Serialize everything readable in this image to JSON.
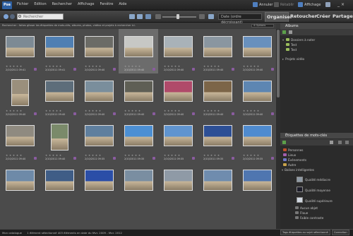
{
  "app": {
    "logo": "Pse"
  },
  "menu": [
    "Fichier",
    "Edition",
    "Rechercher",
    "Affichage",
    "Fenêtre",
    "Aide"
  ],
  "top_right": {
    "undo": "Annuler",
    "redo": "Rétablir",
    "view": "Affichage"
  },
  "search": {
    "placeholder": "Rechercher"
  },
  "sort": {
    "selected": "Date (ordre décroissant)"
  },
  "tabs": [
    "Organiser",
    "Retoucher",
    "Créer",
    "Partager"
  ],
  "filter": {
    "hint": "Rechercher : faites glisser les étiquettes de mots-clés, albums, photos, vidéos et projets à rechercher ici.",
    "dropdown": "4 Options"
  },
  "colors": {
    "accent": "#8a5c9f",
    "selection": "#6c6c6c",
    "panel": "#2b2b2b"
  },
  "thumb_tones": [
    [
      "#7d8a94",
      "#4f7fb3",
      "#6b6b66",
      "#c7c8c5",
      "#a9b2b8",
      "#8a96a0",
      "#6890bd"
    ],
    [
      "#9a8f7c",
      "#5d6d7a",
      "#7a8e9c",
      "#5f5f55",
      "#b04a6a",
      "#7c6548",
      "#5d86b2"
    ],
    [
      "#8f8a80",
      "#7a8a6a",
      "#5f7f9e",
      "#4c8fd3",
      "#6094cf",
      "#2d4f95",
      "#4f8bcf"
    ],
    [
      "#6e8aa8",
      "#3f5d86",
      "#2b4ea7",
      "#7a8ea1",
      "#8f9aa6",
      "#6f8cae",
      "#4f76b0"
    ]
  ],
  "cells": [
    [
      {
        "date": "2/10/2011 09:41"
      },
      {
        "date": "2/10/2011 09:41"
      },
      {
        "date": "2/10/2011 09:40"
      },
      {
        "date": "2/10/2011 09:40"
      },
      {
        "date": "2/10/2011 09:40"
      },
      {
        "date": "2/10/2011 09:40"
      },
      {
        "date": "2/10/2011 09:40"
      }
    ],
    [
      {
        "date": "2/10/2011 09:40"
      },
      {
        "date": "2/10/2011 09:40"
      },
      {
        "date": "2/10/2011 09:40"
      },
      {
        "date": "2/10/2011 09:40"
      },
      {
        "date": "2/10/2011 09:40"
      },
      {
        "date": "2/10/2011 09:40"
      },
      {
        "date": "2/10/2011 09:40"
      }
    ],
    [
      {
        "date": "2/10/2011 09:40"
      },
      {
        "date": "2/10/2011 09:40"
      },
      {
        "date": "2/10/2011 09:35"
      },
      {
        "date": "2/10/2011 09:35"
      },
      {
        "date": "2/10/2011 09:35"
      },
      {
        "date": "2/10/2011 09:35"
      },
      {
        "date": "2/10/2011 09:35"
      }
    ],
    [
      {
        "date": ""
      },
      {
        "date": ""
      },
      {
        "date": ""
      },
      {
        "date": ""
      },
      {
        "date": ""
      },
      {
        "date": ""
      },
      {
        "date": ""
      }
    ]
  ],
  "stars": "★ ★ ★ ★ ★",
  "albums": {
    "title": "Albums",
    "items": [
      {
        "label": "Dossiers à noter"
      },
      {
        "label": "Test"
      },
      {
        "label": "Test"
      },
      {
        "label": "Projets vidéo"
      }
    ]
  },
  "keywords": {
    "title": "Étiquettes de mots-clés",
    "items": [
      {
        "label": "Personnes"
      },
      {
        "label": "Lieux"
      },
      {
        "label": "Événements"
      },
      {
        "label": "Autre"
      },
      {
        "label": "Balises intelligentes"
      },
      {
        "label": "Qualité médiocre"
      },
      {
        "label": "Qualité moyenne"
      },
      {
        "label": "Qualité supérieure"
      },
      {
        "label": "Aucun objet"
      },
      {
        "label": "Floue"
      },
      {
        "label": "Faible contraste"
      }
    ]
  },
  "status": {
    "catalog": "Mon catalogue",
    "selection": "1 élément sélectionné  403 éléments en date du févr. 2009 - févr. 2012",
    "tag_button": "Tags étiquettes au sujet sélectionné",
    "fix_button": "Correction"
  }
}
